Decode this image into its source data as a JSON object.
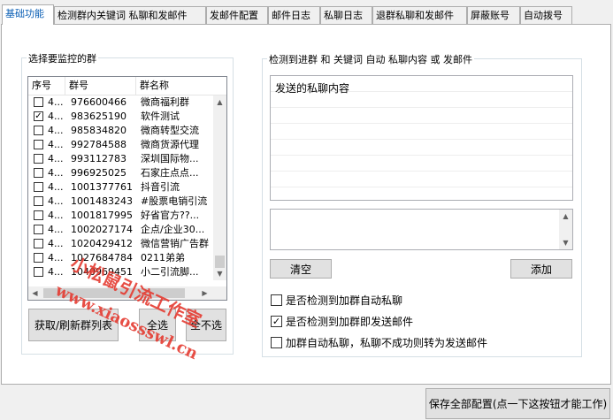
{
  "tabs": [
    {
      "label": "基础功能",
      "active": true
    },
    {
      "label": "检测群内关键词 私聊和发邮件",
      "active": false
    },
    {
      "label": "发邮件配置",
      "active": false
    },
    {
      "label": "邮件日志",
      "active": false
    },
    {
      "label": "私聊日志",
      "active": false
    },
    {
      "label": "退群私聊和发邮件",
      "active": false
    },
    {
      "label": "屏蔽账号",
      "active": false
    },
    {
      "label": "自动拨号",
      "active": false
    }
  ],
  "left_group": {
    "title": "选择要监控的群",
    "columns": [
      "序号",
      "群号",
      "群名称"
    ],
    "rows": [
      {
        "idx": "4...",
        "num": "976600466",
        "name": "微商福利群",
        "checked": false
      },
      {
        "idx": "4...",
        "num": "983625190",
        "name": "软件测试",
        "checked": true
      },
      {
        "idx": "4...",
        "num": "985834820",
        "name": "微商转型交流",
        "checked": false
      },
      {
        "idx": "4...",
        "num": "992784588",
        "name": "微商货源代理",
        "checked": false
      },
      {
        "idx": "4...",
        "num": "993112783",
        "name": "深圳国际物...",
        "checked": false
      },
      {
        "idx": "4...",
        "num": "996925025",
        "name": "石家庄点点...",
        "checked": false
      },
      {
        "idx": "4...",
        "num": "1001377761",
        "name": "抖音引流",
        "checked": false
      },
      {
        "idx": "4...",
        "num": "1001483243",
        "name": "#股票电销引流",
        "checked": false
      },
      {
        "idx": "4...",
        "num": "1001817995",
        "name": "好省官方??...",
        "checked": false
      },
      {
        "idx": "4...",
        "num": "1002027174",
        "name": "企点/企业30...",
        "checked": false
      },
      {
        "idx": "4...",
        "num": "1020429412",
        "name": "微信营销广告群",
        "checked": false
      },
      {
        "idx": "4...",
        "num": "1027684784",
        "name": "0211弟弟",
        "checked": false
      },
      {
        "idx": "4...",
        "num": "1040969451",
        "name": "小二引流脚...",
        "checked": false
      }
    ],
    "btn_refresh": "获取/刷新群列表",
    "btn_select_all": "全选",
    "btn_select_none": "全不选"
  },
  "right_group": {
    "title": "检测到进群 和 关键词 自动 私聊内容 或 发邮件",
    "list_items": [
      "发送的私聊内容"
    ],
    "btn_clear": "清空",
    "btn_add": "添加",
    "options": [
      {
        "label": "是否检测到加群自动私聊",
        "checked": false
      },
      {
        "label": "是否检测到加群即发送邮件",
        "checked": true
      },
      {
        "label": "加群自动私聊，私聊不成功则转为发送邮件",
        "checked": false
      }
    ]
  },
  "btn_save": "保存全部配置(点一下这按钮才能工作)",
  "watermark": {
    "line1": "小松鼠引流工作室",
    "line2": "www.xiaossswl.cn"
  }
}
